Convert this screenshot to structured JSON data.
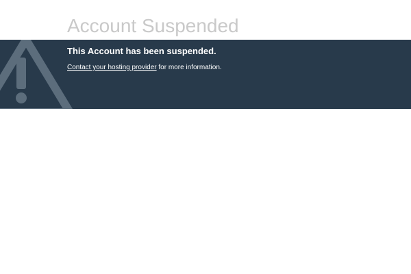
{
  "page": {
    "title": "Account Suspended"
  },
  "banner": {
    "heading": "This Account has been suspended.",
    "link_text": "Contact your hosting provider",
    "info_suffix": " for more information.",
    "icon": "warning-triangle-icon",
    "background_color": "#283a4b",
    "icon_color": "#5c6d7c",
    "title_color": "#c9c9c9"
  }
}
